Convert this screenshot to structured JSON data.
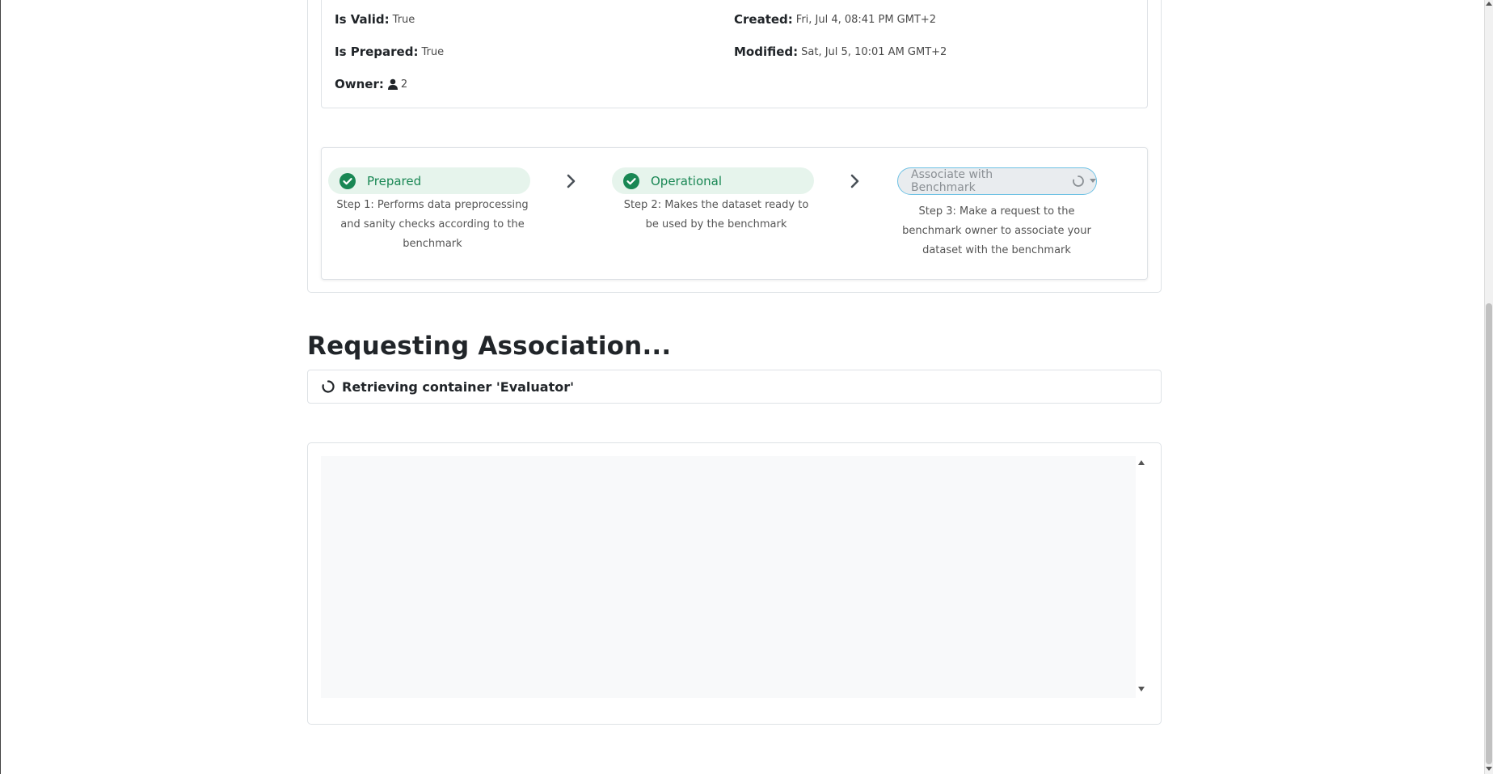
{
  "details": {
    "is_valid_label": "Is Valid:",
    "is_valid_value": "True",
    "is_prepared_label": "Is Prepared:",
    "is_prepared_value": "True",
    "owner_label": "Owner:",
    "owner_value": "2",
    "created_label": "Created:",
    "created_value": "Fri, Jul 4, 08:41 PM GMT+2",
    "modified_label": "Modified:",
    "modified_value": "Sat, Jul 5, 10:01 AM GMT+2"
  },
  "steps": [
    {
      "label": "Prepared",
      "description": "Step 1: Performs data preprocessing and sanity checks according to the benchmark",
      "status": "done"
    },
    {
      "label": "Operational",
      "description": "Step 2: Makes the dataset ready to be used by the benchmark",
      "status": "done"
    },
    {
      "label": "Associate with Benchmark",
      "description": "Step 3: Make a request to the benchmark owner to associate your dataset with the benchmark",
      "status": "loading"
    }
  ],
  "association": {
    "heading": "Requesting Association...",
    "status": "Retrieving container 'Evaluator'"
  },
  "colors": {
    "success": "#198754",
    "success_bg": "#e6f4ec",
    "info_border": "#6ec1e4"
  }
}
